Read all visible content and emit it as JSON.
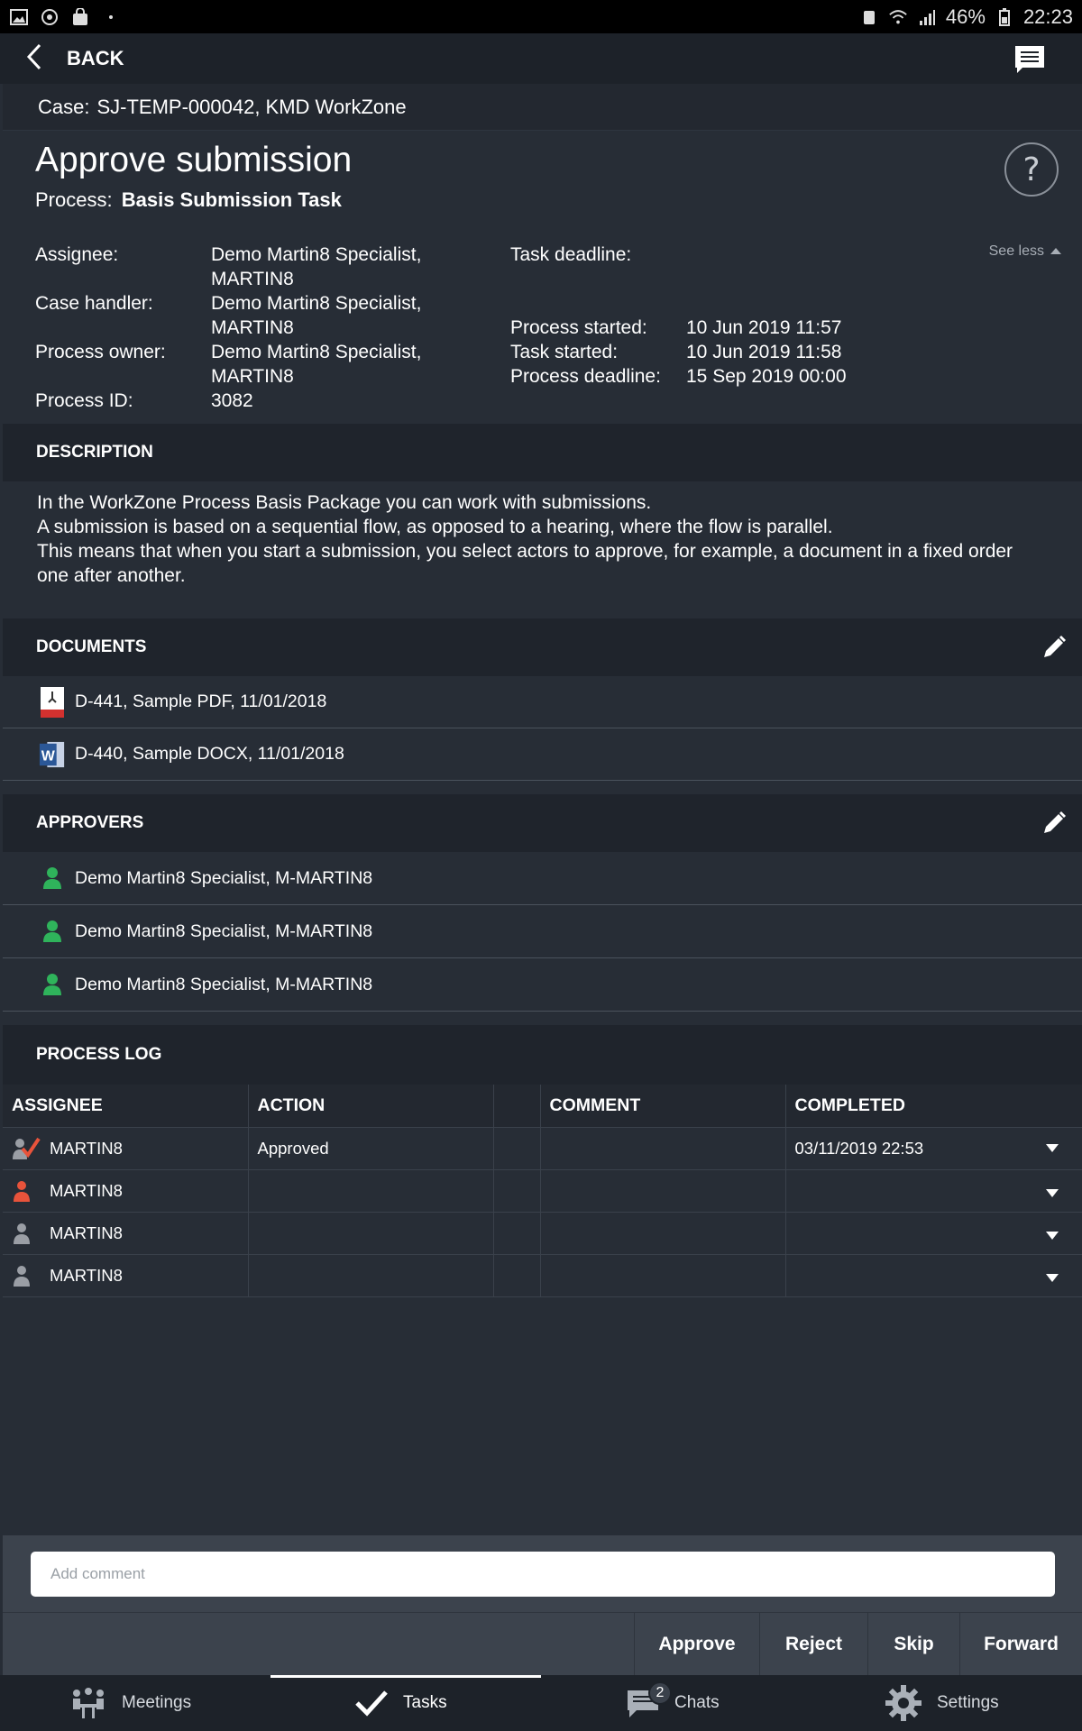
{
  "status_bar": {
    "battery": "46%",
    "time": "22:23"
  },
  "nav": {
    "back_label": "BACK"
  },
  "case": {
    "label": "Case:",
    "value": "SJ-TEMP-000042,  KMD WorkZone"
  },
  "task": {
    "title": "Approve submission",
    "process_label": "Process:",
    "process_name": "Basis Submission Task",
    "help_glyph": "?",
    "see_less": "See less",
    "left_meta": [
      {
        "key": "Assignee:",
        "value_line1": "Demo Martin8 Specialist,",
        "value_line2": "MARTIN8"
      },
      {
        "key": "Case handler:",
        "value_line1": "Demo Martin8 Specialist,",
        "value_line2": "MARTIN8"
      },
      {
        "key": "Process owner:",
        "value_line1": "Demo Martin8 Specialist,",
        "value_line2": "MARTIN8"
      },
      {
        "key": "Process ID:",
        "value_line1": "3082",
        "value_line2": ""
      }
    ],
    "right_meta": [
      {
        "key": "Task deadline:",
        "value": ""
      },
      {
        "key": "Process started:",
        "value": "10 Jun 2019 11:57"
      },
      {
        "key": "Task started:",
        "value": "10 Jun 2019 11:58"
      },
      {
        "key": "Process deadline:",
        "value": "15 Sep 2019 00:00"
      }
    ]
  },
  "description": {
    "heading": "DESCRIPTION",
    "lines": [
      "In the WorkZone Process Basis Package you can work with submissions.",
      "A submission is based on a sequential flow, as opposed to a hearing, where the flow is parallel.",
      "This means that when you start a submission, you select actors to approve, for example, a document in a fixed order",
      "one after another."
    ]
  },
  "documents": {
    "heading": "DOCUMENTS",
    "items": [
      {
        "label": "D-441, Sample PDF, 11/01/2018",
        "icon": "pdf-file-icon"
      },
      {
        "label": "D-440, Sample DOCX, 11/01/2018",
        "icon": "word-file-icon"
      }
    ]
  },
  "approvers": {
    "heading": "APPROVERS",
    "items": [
      {
        "label": "Demo Martin8 Specialist, M-MARTIN8"
      },
      {
        "label": "Demo Martin8 Specialist, M-MARTIN8"
      },
      {
        "label": "Demo Martin8 Specialist, M-MARTIN8"
      }
    ]
  },
  "process_log": {
    "heading": "PROCESS LOG",
    "columns": [
      "ASSIGNEE",
      "ACTION",
      "",
      "COMMENT",
      "COMPLETED"
    ],
    "rows": [
      {
        "assignee": "MARTIN8",
        "action": "Approved",
        "comment": "",
        "completed": "03/11/2019 22:53",
        "status_color": "#e8533b"
      },
      {
        "assignee": "MARTIN8",
        "action": "",
        "comment": "",
        "completed": "",
        "status_color": "#e8533b"
      },
      {
        "assignee": "MARTIN8",
        "action": "",
        "comment": "",
        "completed": "",
        "status_color": "#9a9ea5"
      },
      {
        "assignee": "MARTIN8",
        "action": "",
        "comment": "",
        "completed": "",
        "status_color": "#9a9ea5"
      }
    ]
  },
  "comment": {
    "placeholder": "Add comment"
  },
  "actions": {
    "approve": "Approve",
    "reject": "Reject",
    "skip": "Skip",
    "forward": "Forward"
  },
  "bottom_nav": {
    "meetings": "Meetings",
    "tasks": "Tasks",
    "chats": "Chats",
    "chats_badge": "2",
    "settings": "Settings"
  },
  "colors": {
    "accent_green": "#2fb35b",
    "alert_red": "#e8533b",
    "pdf_red": "#d3312f",
    "word_blue": "#2b5797"
  }
}
